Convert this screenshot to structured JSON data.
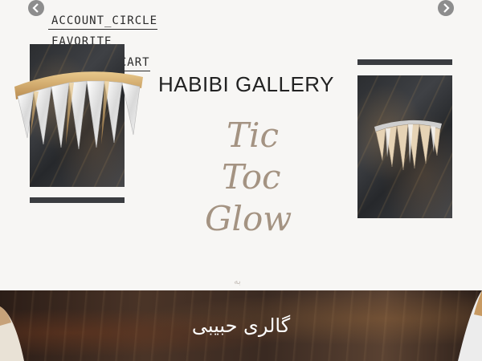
{
  "nav": {
    "prev_icon": "chevron-left-icon",
    "next_icon": "chevron-right-icon"
  },
  "header_links": {
    "account": "ACCOUNT_CIRCLE",
    "favorite": "FAVORITE",
    "cart": "SHOPPING_CART"
  },
  "title": "HABIBI GALLERY",
  "script_text": [
    "Tic",
    "Toc",
    "Glow"
  ],
  "small_mark": "به",
  "banner": {
    "text": "گالری حبیبی"
  },
  "colors": {
    "script": "#a49382",
    "marble": "#2b2d30",
    "banner": "#4a3427"
  }
}
